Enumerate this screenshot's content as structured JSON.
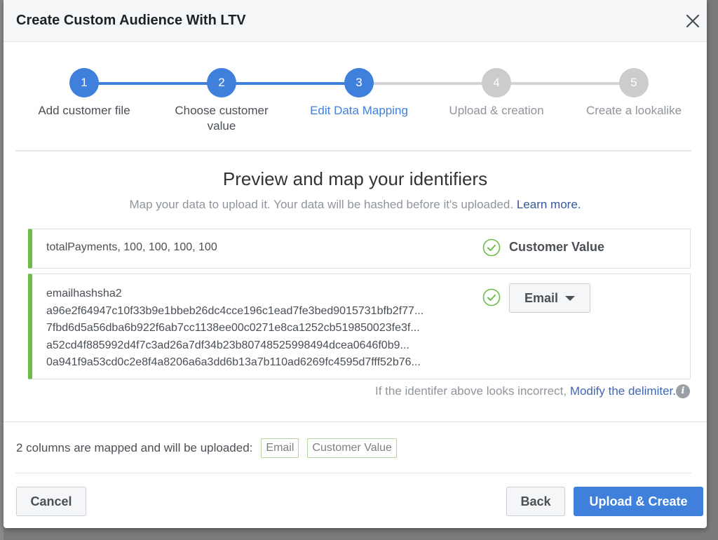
{
  "modal": {
    "title": "Create Custom Audience With LTV",
    "close_icon": "close-icon"
  },
  "stepper": {
    "current_step": 3,
    "steps": [
      {
        "number": "1",
        "label": "Add customer file",
        "state": "complete"
      },
      {
        "number": "2",
        "label": "Choose customer value",
        "state": "complete"
      },
      {
        "number": "3",
        "label": "Edit Data Mapping",
        "state": "active"
      },
      {
        "number": "4",
        "label": "Upload & creation",
        "state": "todo"
      },
      {
        "number": "5",
        "label": "Create a lookalike",
        "state": "todo"
      }
    ]
  },
  "section": {
    "title": "Preview and map your identifiers",
    "subtitle": "Map your data to upload it. Your data will be hashed before it's uploaded.",
    "learn_more": "Learn more."
  },
  "mappings": [
    {
      "lines": [
        "totalPayments, 100, 100, 100, 100"
      ],
      "status_icon": "check-circle-icon",
      "mapped_to": "Customer Value"
    },
    {
      "lines": [
        "emailhashsha2",
        "a96e2f64947c10f33b9e1bbeb26dc4cce196c1ead7fe3bed9015731bfb2f77...",
        "7fbd6d5a56dba6b922f6ab7cc1138ee00c0271e8ca1252cb519850023fe3f...",
        "a52cd4f885992d4f7c3ad26a7df34b23b80748525998494dcea0646f0b9...",
        "0a941f9a53cd0c2e8f4a8206a6a3dd6b13a7b110ad6269fc4595d7fff52b76..."
      ],
      "status_icon": "check-circle-icon",
      "mapped_to": "Email",
      "dropdown_icon": "caret-down-icon"
    }
  ],
  "delimiter": {
    "text": "If the identifer above looks incorrect,",
    "link": "Modify the delimiter.",
    "info_icon": "info-icon",
    "info_glyph": "i"
  },
  "summary": {
    "text": "2 columns are mapped and will be uploaded:",
    "tags": [
      "Email",
      "Customer Value"
    ]
  },
  "footer": {
    "cancel_label": "Cancel",
    "back_label": "Back",
    "primary_label": "Upload & Create"
  },
  "colors": {
    "accent": "#4080dd",
    "inactive_step": "#cccccc",
    "success": "#6bbd45",
    "link": "#365899"
  }
}
